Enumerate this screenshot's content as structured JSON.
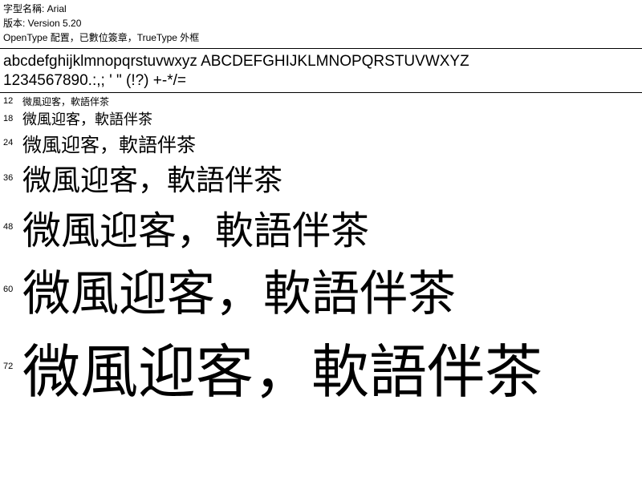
{
  "header": {
    "font_name_label": "字型名稱: ",
    "font_name_value": "Arial",
    "version_label": "版本: ",
    "version_value": "Version 5.20",
    "features": "OpenType 配置，已數位簽章，TrueType 外框"
  },
  "specimen": {
    "line1": "abcdefghijklmnopqrstuvwxyz ABCDEFGHIJKLMNOPQRSTUVWXYZ",
    "line2": "1234567890.:,; ' \" (!?) +-*/="
  },
  "sample_text": "微風迎客，軟語伴茶",
  "sizes": [
    12,
    18,
    24,
    36,
    48,
    60,
    72
  ]
}
